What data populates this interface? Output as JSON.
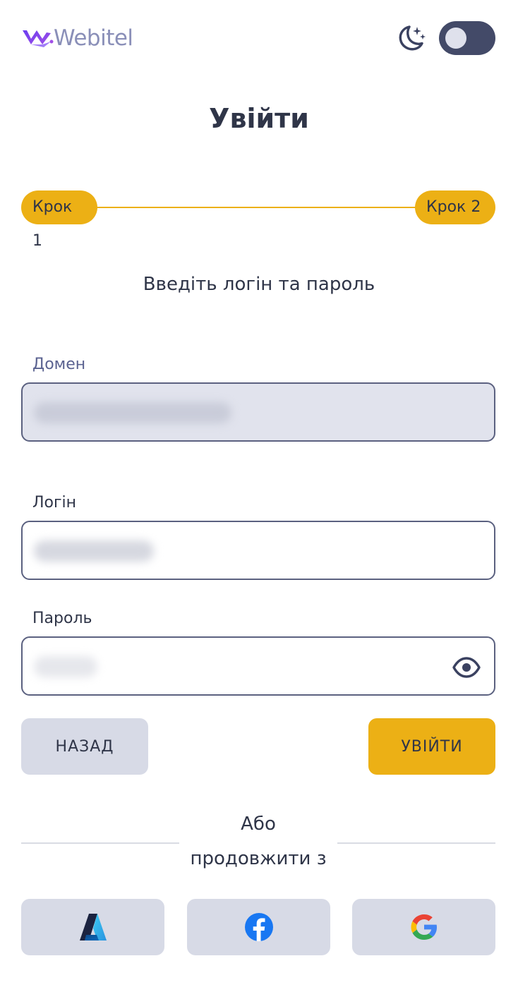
{
  "header": {
    "logo_text": "Webitel",
    "icons": {
      "theme": "moon-stars-icon"
    },
    "theme_toggle_on": false
  },
  "title": "Увійти",
  "stepper": {
    "steps": [
      "Крок 1",
      "Крок 2"
    ],
    "current": 2
  },
  "subtitle": "Введіть логін та пароль",
  "form": {
    "domain": {
      "label": "Домен"
    },
    "login": {
      "label": "Логін"
    },
    "password": {
      "label": "Пароль",
      "toggle_icon": "eye-icon"
    }
  },
  "buttons": {
    "back": "НАЗАД",
    "submit": "УВІЙТИ"
  },
  "divider": {
    "or": "Або",
    "continue_with": "продовжити з"
  },
  "social": [
    {
      "provider": "azure",
      "icon": "azure-icon"
    },
    {
      "provider": "facebook",
      "icon": "facebook-icon"
    },
    {
      "provider": "google",
      "icon": "google-icon"
    }
  ],
  "colors": {
    "accent": "#ecb015",
    "text": "#2f3548",
    "field_border": "#5b6180",
    "button_secondary": "#d7dae6",
    "toggle": "#434a68"
  }
}
